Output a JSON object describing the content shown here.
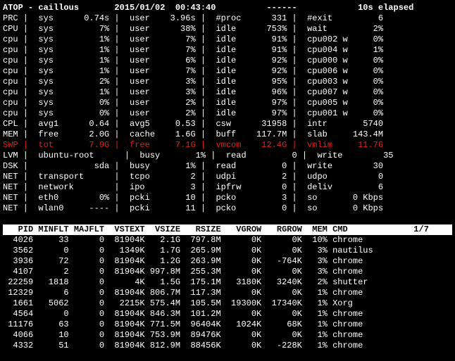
{
  "header": {
    "prog": "ATOP",
    "host": "caillous",
    "date": "2015/01/02",
    "time": "00:43:40",
    "dots": "------",
    "elapsed": "10s elapsed"
  },
  "syslines": [
    {
      "tag": "PRC",
      "red": false,
      "c1l": "sys",
      "c1v": "0.74s",
      "c2l": "user",
      "c2v": "3.96s",
      "c3l": "#proc",
      "c3v": "331",
      "c4l": "#exit",
      "c4v": "6"
    },
    {
      "tag": "CPU",
      "red": false,
      "c1l": "sys",
      "c1v": "7%",
      "c2l": "user",
      "c2v": "38%",
      "c3l": "idle",
      "c3v": "753%",
      "c4l": "wait",
      "c4v": "2%"
    },
    {
      "tag": "cpu",
      "red": false,
      "c1l": "sys",
      "c1v": "1%",
      "c2l": "user",
      "c2v": "7%",
      "c3l": "idle",
      "c3v": "91%",
      "c4l": "cpu002 w",
      "c4v": "0%"
    },
    {
      "tag": "cpu",
      "red": false,
      "c1l": "sys",
      "c1v": "1%",
      "c2l": "user",
      "c2v": "7%",
      "c3l": "idle",
      "c3v": "91%",
      "c4l": "cpu004 w",
      "c4v": "1%"
    },
    {
      "tag": "cpu",
      "red": false,
      "c1l": "sys",
      "c1v": "1%",
      "c2l": "user",
      "c2v": "6%",
      "c3l": "idle",
      "c3v": "92%",
      "c4l": "cpu000 w",
      "c4v": "0%"
    },
    {
      "tag": "cpu",
      "red": false,
      "c1l": "sys",
      "c1v": "1%",
      "c2l": "user",
      "c2v": "7%",
      "c3l": "idle",
      "c3v": "92%",
      "c4l": "cpu006 w",
      "c4v": "0%"
    },
    {
      "tag": "cpu",
      "red": false,
      "c1l": "sys",
      "c1v": "2%",
      "c2l": "user",
      "c2v": "3%",
      "c3l": "idle",
      "c3v": "95%",
      "c4l": "cpu003 w",
      "c4v": "0%"
    },
    {
      "tag": "cpu",
      "red": false,
      "c1l": "sys",
      "c1v": "1%",
      "c2l": "user",
      "c2v": "3%",
      "c3l": "idle",
      "c3v": "96%",
      "c4l": "cpu007 w",
      "c4v": "0%"
    },
    {
      "tag": "cpu",
      "red": false,
      "c1l": "sys",
      "c1v": "0%",
      "c2l": "user",
      "c2v": "2%",
      "c3l": "idle",
      "c3v": "97%",
      "c4l": "cpu005 w",
      "c4v": "0%"
    },
    {
      "tag": "cpu",
      "red": false,
      "c1l": "sys",
      "c1v": "0%",
      "c2l": "user",
      "c2v": "2%",
      "c3l": "idle",
      "c3v": "97%",
      "c4l": "cpu001 w",
      "c4v": "0%"
    },
    {
      "tag": "CPL",
      "red": false,
      "c1l": "avg1",
      "c1v": "0.64",
      "c2l": "avg5",
      "c2v": "0.53",
      "c3l": "csw",
      "c3v": "31958",
      "c4l": "intr",
      "c4v": "5740"
    },
    {
      "tag": "MEM",
      "red": false,
      "c1l": "free",
      "c1v": "2.0G",
      "c2l": "cache",
      "c2v": "1.6G",
      "c3l": "buff",
      "c3v": "117.7M",
      "c4l": "slab",
      "c4v": "143.4M"
    },
    {
      "tag": "SWP",
      "red": true,
      "c1l": "tot",
      "c1v": "7.9G",
      "c2l": "free",
      "c2v": "7.1G",
      "c3l": "vmcom",
      "c3v": "12.4G",
      "c4l": "vmlim",
      "c4v": "11.7G"
    },
    {
      "tag": "LVM",
      "red": false,
      "c1l": "ubuntu-root",
      "c1v": "",
      "c2l": "busy",
      "c2v": "1%",
      "c3l": "read",
      "c3v": "0",
      "c4l": "write",
      "c4v": "35"
    },
    {
      "tag": "DSK",
      "red": false,
      "c1l": "",
      "c1v": "sda",
      "c2l": "busy",
      "c2v": "1%",
      "c3l": "read",
      "c3v": "0",
      "c4l": "write",
      "c4v": "30"
    },
    {
      "tag": "NET",
      "red": false,
      "c1l": "transport",
      "c1v": "",
      "c2l": "tcpo",
      "c2v": "2",
      "c3l": "udpi",
      "c3v": "2",
      "c4l": "udpo",
      "c4v": "0"
    },
    {
      "tag": "NET",
      "red": false,
      "c1l": "network",
      "c1v": "",
      "c2l": "ipo",
      "c2v": "3",
      "c3l": "ipfrw",
      "c3v": "0",
      "c4l": "deliv",
      "c4v": "6"
    },
    {
      "tag": "NET",
      "red": false,
      "c1l": "eth0",
      "c1v": "0%",
      "c2l": "pcki",
      "c2v": "10",
      "c3l": "pcko",
      "c3v": "3",
      "c4l": "so",
      "c4v": "0 Kbps"
    },
    {
      "tag": "NET",
      "red": false,
      "c1l": "wlan0",
      "c1v": "----",
      "c2l": "pcki",
      "c2v": "11",
      "c3l": "pcko",
      "c3v": "0",
      "c4l": "so",
      "c4v": "0 Kbps"
    }
  ],
  "proc_header": {
    "cols": [
      "PID",
      "MINFLT",
      "MAJFLT",
      "VSTEXT",
      "VSIZE",
      "RSIZE",
      "VGROW",
      "RGROW",
      "MEM",
      "CMD"
    ],
    "page": "1/7"
  },
  "procs": [
    {
      "pid": "4026",
      "minflt": "33",
      "majflt": "0",
      "vstext": "81904K",
      "vsize": "2.1G",
      "rsize": "797.8M",
      "vgrow": "0K",
      "rgrow": "0K",
      "mem": "10%",
      "cmd": "chrome"
    },
    {
      "pid": "3562",
      "minflt": "0",
      "majflt": "0",
      "vstext": "1349K",
      "vsize": "1.7G",
      "rsize": "265.9M",
      "vgrow": "0K",
      "rgrow": "0K",
      "mem": "3%",
      "cmd": "nautilus"
    },
    {
      "pid": "3936",
      "minflt": "72",
      "majflt": "0",
      "vstext": "81904K",
      "vsize": "1.2G",
      "rsize": "263.9M",
      "vgrow": "0K",
      "rgrow": "-764K",
      "mem": "3%",
      "cmd": "chrome"
    },
    {
      "pid": "4107",
      "minflt": "2",
      "majflt": "0",
      "vstext": "81904K",
      "vsize": "997.8M",
      "rsize": "255.3M",
      "vgrow": "0K",
      "rgrow": "0K",
      "mem": "3%",
      "cmd": "chrome"
    },
    {
      "pid": "22259",
      "minflt": "1818",
      "majflt": "0",
      "vstext": "4K",
      "vsize": "1.5G",
      "rsize": "175.1M",
      "vgrow": "3180K",
      "rgrow": "3240K",
      "mem": "2%",
      "cmd": "shutter"
    },
    {
      "pid": "12329",
      "minflt": "6",
      "majflt": "0",
      "vstext": "81904K",
      "vsize": "806.7M",
      "rsize": "117.3M",
      "vgrow": "0K",
      "rgrow": "0K",
      "mem": "1%",
      "cmd": "chrome"
    },
    {
      "pid": "1661",
      "minflt": "5062",
      "majflt": "0",
      "vstext": "2215K",
      "vsize": "575.4M",
      "rsize": "105.5M",
      "vgrow": "19300K",
      "rgrow": "17340K",
      "mem": "1%",
      "cmd": "Xorg"
    },
    {
      "pid": "4564",
      "minflt": "0",
      "majflt": "0",
      "vstext": "81904K",
      "vsize": "846.3M",
      "rsize": "101.2M",
      "vgrow": "0K",
      "rgrow": "0K",
      "mem": "1%",
      "cmd": "chrome"
    },
    {
      "pid": "11176",
      "minflt": "63",
      "majflt": "0",
      "vstext": "81904K",
      "vsize": "771.5M",
      "rsize": "96404K",
      "vgrow": "1024K",
      "rgrow": "68K",
      "mem": "1%",
      "cmd": "chrome"
    },
    {
      "pid": "4066",
      "minflt": "10",
      "majflt": "0",
      "vstext": "81904K",
      "vsize": "753.9M",
      "rsize": "89476K",
      "vgrow": "0K",
      "rgrow": "0K",
      "mem": "1%",
      "cmd": "chrome"
    },
    {
      "pid": "4332",
      "minflt": "51",
      "majflt": "0",
      "vstext": "81904K",
      "vsize": "812.9M",
      "rsize": "88456K",
      "vgrow": "0K",
      "rgrow": "-228K",
      "mem": "1%",
      "cmd": "chrome"
    }
  ]
}
